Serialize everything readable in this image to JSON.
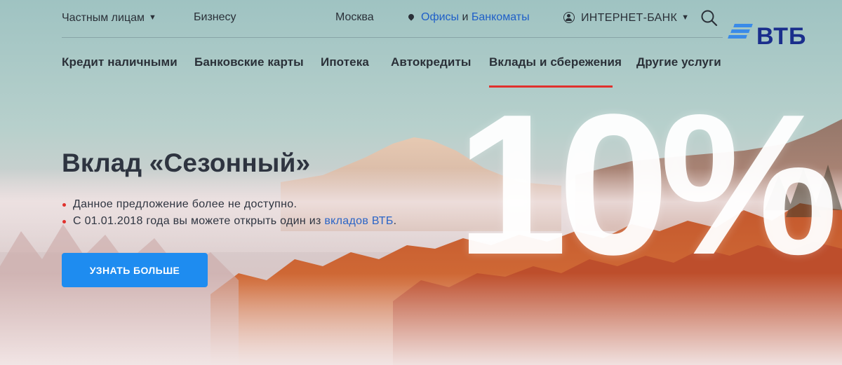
{
  "topbar": {
    "individuals": "Частным лицам",
    "business": "Бизнесу",
    "city": "Москва",
    "offices": "Офисы",
    "and": "и",
    "atms": "Банкоматы",
    "internet_bank": "ИНТЕРНЕТ-БАНК"
  },
  "logo": {
    "text": "ВТБ"
  },
  "nav": {
    "items": [
      "Кредит наличными",
      "Банковские карты",
      "Ипотека",
      "Автокредиты",
      "Вклады и сбережения",
      "Другие услуги"
    ],
    "active_index": 4
  },
  "hero": {
    "title": "Вклад «Сезонный»",
    "bullet_1": "Данное предложение более не доступно.",
    "bullet_2_prefix": "С 01.01.2018 года вы можете открыть один из ",
    "bullet_2_link": "вкладов ВТБ",
    "bullet_2_suffix": ".",
    "cta_label": "УЗНАТЬ БОЛЬШЕ",
    "big_number": "10%"
  },
  "colors": {
    "accent_blue": "#1e8cf0",
    "link_blue": "#1f5fc8",
    "logo_navy": "#1a2e8c",
    "underline_red": "#e0312d"
  },
  "icons": {
    "search": "search-icon",
    "user": "user-icon",
    "pin": "map-pin-icon",
    "caret": "chevron-down-icon"
  }
}
